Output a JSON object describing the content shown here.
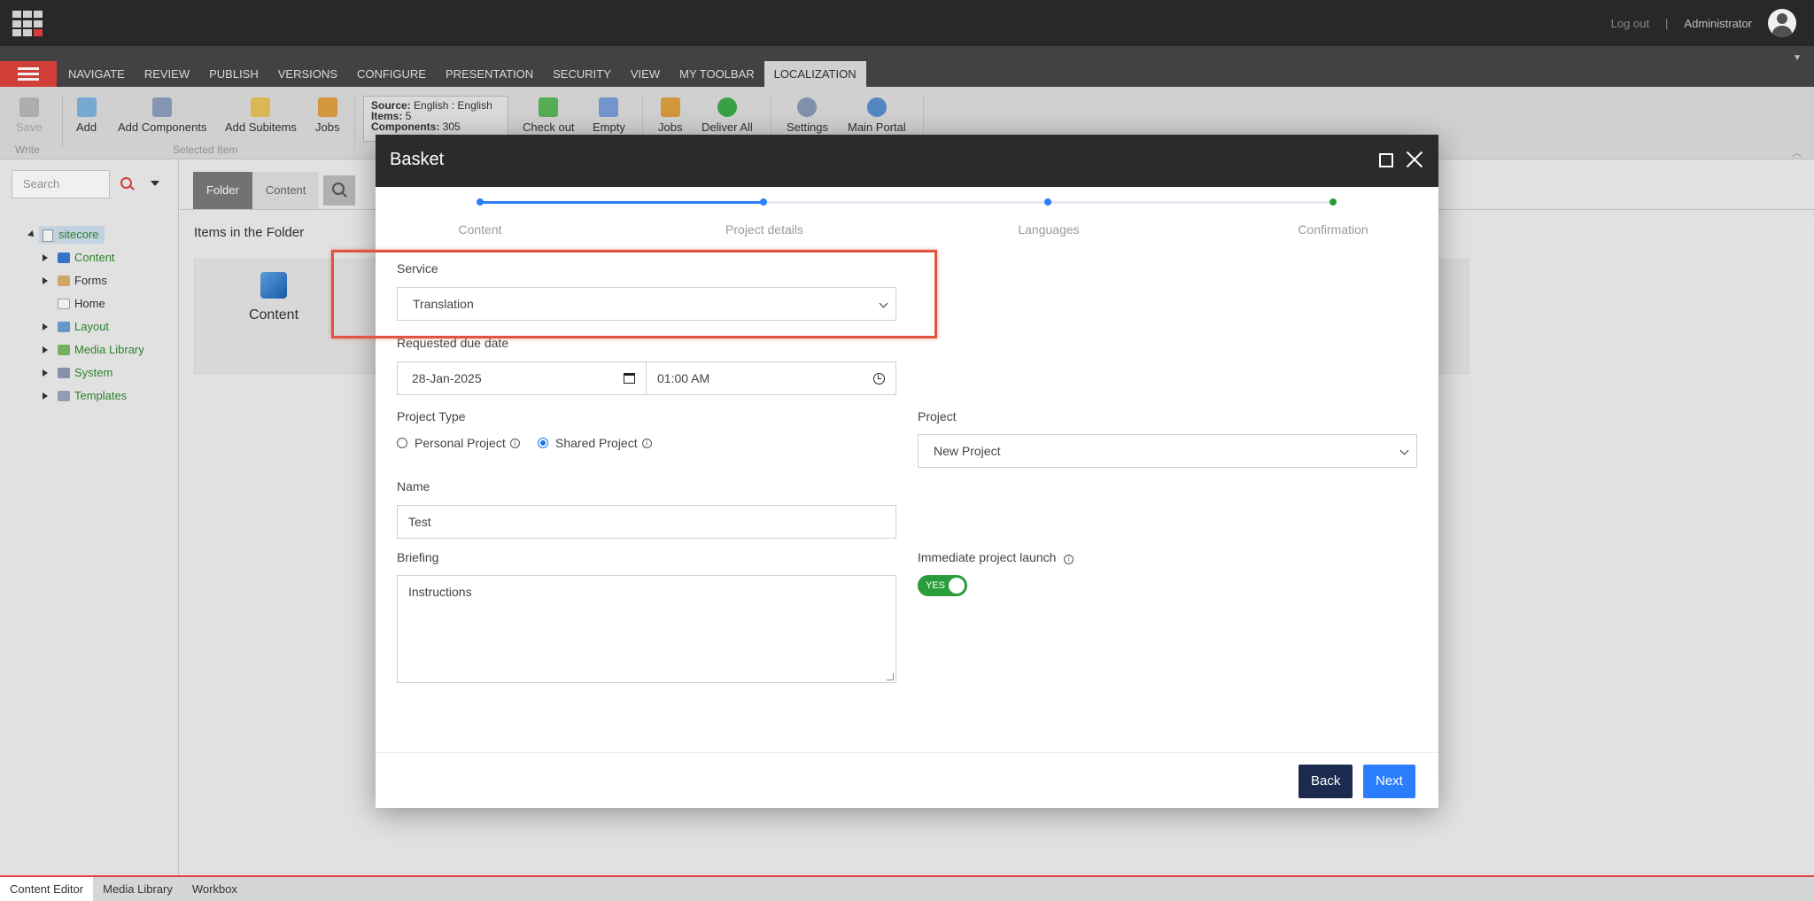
{
  "topbar": {
    "logout": "Log out",
    "separator": "|",
    "user": "Administrator"
  },
  "ribbon_tabs": [
    "NAVIGATE",
    "REVIEW",
    "PUBLISH",
    "VERSIONS",
    "CONFIGURE",
    "PRESENTATION",
    "SECURITY",
    "VIEW",
    "MY TOOLBAR",
    "LOCALIZATION"
  ],
  "active_ribbon_tab": "LOCALIZATION",
  "ribbon": {
    "save": "Save",
    "write_group": "Write",
    "add": "Add",
    "add_components": "Add Components",
    "add_subitems": "Add Subitems",
    "jobs": "Jobs",
    "selected_item_group": "Selected Item",
    "basket_info": {
      "source_label": "Source:",
      "source_value": "English : English",
      "items_label": "Items:",
      "items_value": "5",
      "components_label": "Components:",
      "components_value": "305"
    },
    "check_out": "Check out",
    "empty": "Empty",
    "jobs2": "Jobs",
    "deliver_all": "Deliver All",
    "settings": "Settings",
    "main_portal": "Main Portal"
  },
  "leftpane": {
    "search_placeholder": "Search",
    "tree": {
      "root": "sitecore",
      "items": [
        "Content",
        "Forms",
        "Home",
        "Layout",
        "Media Library",
        "System",
        "Templates"
      ]
    }
  },
  "main": {
    "tabs": [
      "Folder",
      "Content"
    ],
    "folder_title": "Items in the Folder",
    "folder_item": "Content"
  },
  "statusbar": [
    "Content Editor",
    "Media Library",
    "Workbox"
  ],
  "modal": {
    "title": "Basket",
    "steps": [
      "Content",
      "Project details",
      "Languages",
      "Confirmation"
    ],
    "service_label": "Service",
    "service_value": "Translation",
    "due_date_label": "Requested due date",
    "due_date": "28-Jan-2025",
    "due_time": "01:00 AM",
    "project_type_label": "Project Type",
    "project_type_options": [
      "Personal Project",
      "Shared Project"
    ],
    "project_type_selected": "Shared Project",
    "project_label": "Project",
    "project_value": "New Project",
    "name_label": "Name",
    "name_value": "Test",
    "briefing_label": "Briefing",
    "briefing_value": "Instructions",
    "launch_label": "Immediate project launch",
    "launch_toggle": "YES",
    "back_button": "Back",
    "next_button": "Next"
  },
  "colors": {
    "accent_red": "#e0433c",
    "primary_blue": "#2a7dfb",
    "dark_navy": "#1b2a4e",
    "toggle_green": "#2a9d3a",
    "tree_green": "#2e8b2e"
  }
}
